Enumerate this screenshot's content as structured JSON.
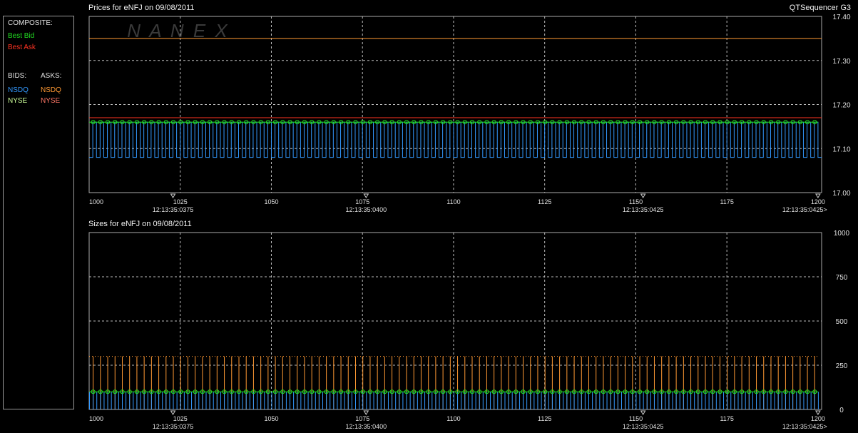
{
  "app_name": "QTSequencer G3",
  "watermark": "NANEX",
  "legend": {
    "composite_header": "COMPOSITE:",
    "best_bid": "Best Bid",
    "best_ask": "Best Ask",
    "bids_header": "BIDS:",
    "asks_header": "ASKS:",
    "bids": [
      "NSDQ",
      "NYSE"
    ],
    "asks": [
      "NSDQ",
      "NYSE"
    ]
  },
  "colors": {
    "best_bid": "#22dd22",
    "best_ask": "#ff3322",
    "nsdq_bid": "#3399ff",
    "nyse_bid": "#ccff99",
    "nsdq_ask": "#ff9933",
    "nyse_ask": "#ff7766"
  },
  "chart_data": [
    {
      "type": "line",
      "title": "Prices for  eNFJ  on  09/08/2011",
      "x_ticks": [
        "1000",
        "1025",
        "1050",
        "1075",
        "1100",
        "1125",
        "1150",
        "1175",
        "1200"
      ],
      "xlim": [
        1000,
        1201
      ],
      "time_markers": [
        {
          "x": 1023,
          "label": "12:13:35:0375"
        },
        {
          "x": 1076,
          "label": "12:13:35:0400"
        },
        {
          "x": 1152,
          "label": "12:13:35:0425"
        },
        {
          "x": 1200,
          "label": "12:13:35:0425>"
        }
      ],
      "y_ticks": [
        "17.40",
        "17.30",
        "17.20",
        "17.10",
        "17.00"
      ],
      "ylim": [
        17.0,
        17.4
      ],
      "series": [
        {
          "name": "Best Ask",
          "constant": 17.17
        },
        {
          "name": "NSDQ",
          "side": "ask",
          "constant": 17.35
        },
        {
          "name": "NSDQ",
          "side": "bid",
          "oscillating_between": [
            17.08,
            17.16
          ],
          "period": 2
        },
        {
          "name": "Best Bid",
          "constant": 17.16
        }
      ],
      "grid": true
    },
    {
      "type": "line",
      "title": "Sizes for  eNFJ  on  09/08/2011",
      "x_ticks": [
        "1000",
        "1025",
        "1050",
        "1075",
        "1100",
        "1125",
        "1150",
        "1175",
        "1200"
      ],
      "xlim": [
        1000,
        1201
      ],
      "time_markers": [
        {
          "x": 1023,
          "label": "12:13:35:0375"
        },
        {
          "x": 1076,
          "label": "12:13:35:0400"
        },
        {
          "x": 1152,
          "label": "12:13:35:0425"
        },
        {
          "x": 1200,
          "label": "12:13:35:0425>"
        }
      ],
      "y_ticks": [
        "1000",
        "750",
        "500",
        "250",
        "0"
      ],
      "ylim": [
        0,
        1000
      ],
      "series": [
        {
          "name": "NSDQ",
          "side": "ask",
          "oscillating_between": [
            0,
            300
          ],
          "period": 2
        },
        {
          "name": "NSDQ",
          "side": "bid",
          "oscillating_between": [
            0,
            100
          ],
          "period": 2
        },
        {
          "name": "Best Bid",
          "constant": 100
        }
      ],
      "grid": true
    }
  ]
}
